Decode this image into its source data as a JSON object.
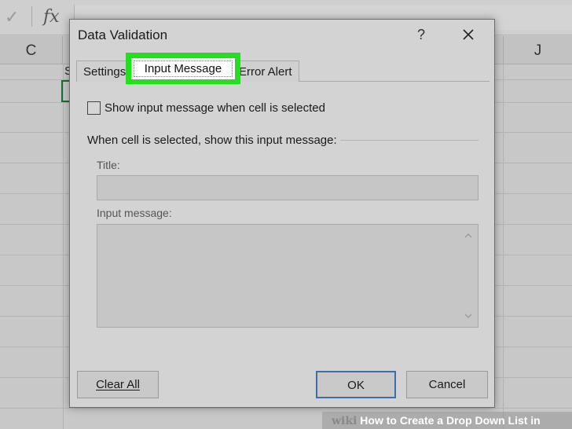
{
  "excel": {
    "check_glyph": "✓",
    "fx_label": "fx",
    "columns": [
      {
        "id": "c",
        "label": "C"
      },
      {
        "id": "j",
        "label": "J"
      }
    ],
    "partial_cell_text": "S"
  },
  "dialog": {
    "title": "Data Validation",
    "help_label": "?",
    "close_icon": "close-icon",
    "tabs": [
      {
        "label": "Settings",
        "active": false
      },
      {
        "label": "Input Message",
        "active": true
      },
      {
        "label": "Error Alert",
        "active": false
      }
    ],
    "highlight_color": "#23e01f",
    "show_input_checkbox": {
      "label": "Show input message when cell is selected",
      "checked": false
    },
    "group_label": "When cell is selected, show this input message:",
    "title_field": {
      "label": "Title:",
      "value": ""
    },
    "message_field": {
      "label": "Input message:",
      "value": ""
    },
    "buttons": {
      "clear_all": "Clear All",
      "ok": "OK",
      "cancel": "Cancel"
    }
  },
  "watermark": {
    "brand": "wiki",
    "text": "How to Create a Drop Down List in Excel"
  }
}
